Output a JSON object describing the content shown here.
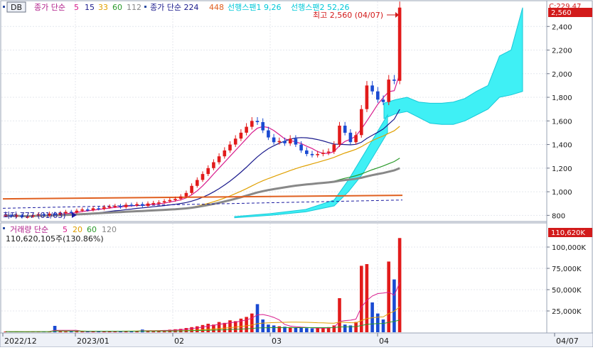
{
  "header": {
    "symbol": "DB",
    "ma_title": "종가 단순",
    "ma_periods": [
      "5",
      "15",
      "33",
      "60",
      "112"
    ],
    "ma_colors": [
      "#d81b8c",
      "#1a1a8c",
      "#e0a000",
      "#2a9a2a",
      "#888888"
    ],
    "ma2_title": "종가 단순 224",
    "ma2_period2": "448",
    "span1": "선행스팬1 9,26",
    "span2": "선행스팬2 52,26",
    "top_right_code": "C:229,47"
  },
  "annotations": {
    "high": "최고 2,560 (04/07)",
    "low": "최저 777 (01/03)",
    "last_price_badge": "2,560",
    "last_volume_badge": "110,620K"
  },
  "volume_header": {
    "title": "거래량 단순",
    "periods": [
      "5",
      "20",
      "60",
      "120"
    ],
    "period_colors": [
      "#d81b8c",
      "#e0a000",
      "#2a9a2a",
      "#888888"
    ],
    "last_value": "110,620,105주(130.86%)"
  },
  "chart_data": [
    {
      "type": "candlestick",
      "title": "DB",
      "y_ticks": [
        "2,400",
        "2,200",
        "2,000",
        "1,800",
        "1,600",
        "1,400",
        "1,200",
        "1,000",
        "800"
      ],
      "ylim": [
        760,
        2600
      ],
      "x_ticks": [
        "2022/12",
        "2023/01",
        "02",
        "03",
        "04",
        "04/07"
      ],
      "grid": true,
      "series": [
        {
          "name": "price",
          "values": [
            800,
            790,
            800,
            785,
            790,
            800,
            810,
            800,
            815,
            805,
            820,
            830,
            825,
            840,
            850,
            845,
            860,
            855,
            870,
            875,
            880,
            870,
            890,
            885,
            895,
            880,
            900,
            905,
            910,
            920,
            930,
            940,
            960,
            990,
            1050,
            1100,
            1150,
            1200,
            1250,
            1300,
            1350,
            1400,
            1450,
            1500,
            1550,
            1600,
            1590,
            1520,
            1460,
            1420,
            1430,
            1410,
            1450,
            1400,
            1350,
            1320,
            1310,
            1320,
            1330,
            1340,
            1400,
            1560,
            1500,
            1420,
            1480,
            1700,
            1900,
            1850,
            1780,
            1760,
            1950,
            1940,
            2560
          ]
        }
      ],
      "ichimoku_cloud_top": [
        1750,
        1780,
        1800,
        1760,
        1750,
        1750,
        1760,
        1790,
        1850,
        1900,
        2150,
        2200,
        2560
      ],
      "ichimoku_cloud_bottom": [
        1620,
        1660,
        1680,
        1630,
        1580,
        1570,
        1570,
        1600,
        1650,
        1700,
        1800,
        1820,
        1850
      ]
    },
    {
      "type": "bar",
      "title": "거래량",
      "y_ticks": [
        "100,000K",
        "75,000K",
        "50,000K",
        "25,000K"
      ],
      "ylim": [
        0,
        115000
      ],
      "values_k": [
        800,
        600,
        900,
        500,
        700,
        800,
        900,
        1000,
        800,
        7500,
        1200,
        900,
        1100,
        800,
        900,
        1000,
        1200,
        900,
        1100,
        1000,
        1300,
        1100,
        1200,
        1400,
        1600,
        3200,
        1800,
        1500,
        2000,
        2500,
        3000,
        3500,
        4000,
        5000,
        6000,
        7000,
        8500,
        10000,
        9000,
        12000,
        11000,
        14000,
        13000,
        16000,
        18000,
        22000,
        33000,
        15000,
        9000,
        8000,
        7000,
        6500,
        6000,
        5500,
        5000,
        4800,
        4500,
        4700,
        5200,
        6000,
        8000,
        40000,
        9000,
        8000,
        12000,
        78000,
        80000,
        35000,
        22000,
        15000,
        83000,
        62000,
        110620
      ]
    }
  ]
}
